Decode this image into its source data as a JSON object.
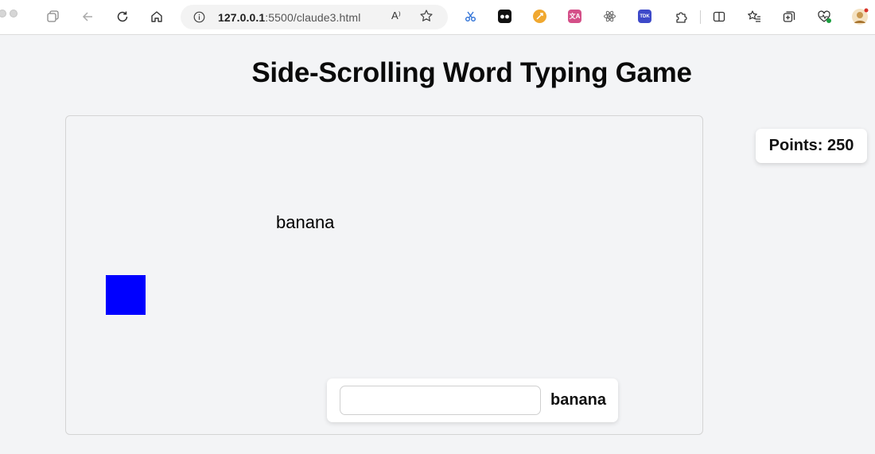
{
  "browser": {
    "url_host": "127.0.0.1",
    "url_rest": ":5500/claude3.html",
    "read_aloud_label": "A⁾",
    "extensions": [
      {
        "name": "scissors-extension-icon",
        "color": "#2b6fd6",
        "text": "✂"
      },
      {
        "name": "glasses-extension-icon",
        "color": "#111111",
        "text": ""
      },
      {
        "name": "orange-extension-icon",
        "color": "#f0a830",
        "text": ""
      },
      {
        "name": "translate-extension-icon",
        "color": "#d44f88",
        "text": "文A"
      },
      {
        "name": "atom-extension-icon",
        "color": "#6a6a6a",
        "text": ""
      },
      {
        "name": "tdk-extension-icon",
        "color": "#3d49c9",
        "text": "TDK"
      }
    ]
  },
  "page": {
    "title": "Side-Scrolling Word Typing Game"
  },
  "game": {
    "falling_word": "banana",
    "input": {
      "value": "",
      "placeholder": ""
    },
    "target_word": "banana",
    "points_label": "Points: 250",
    "player_color": "#0000ff"
  }
}
